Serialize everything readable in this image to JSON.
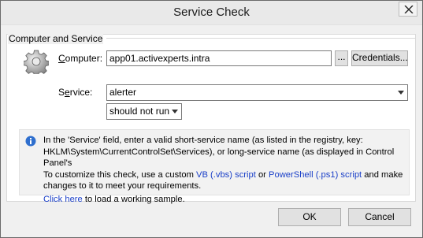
{
  "window": {
    "title": "Service Check"
  },
  "group": {
    "label": "Computer and Service"
  },
  "computer": {
    "label_underlined": "C",
    "label_rest": "omputer:",
    "value": "app01.activexperts.intra",
    "browse_label": "...",
    "credentials_label": "Credentials..."
  },
  "service": {
    "label_prefix": "S",
    "label_underlined": "e",
    "label_rest": "rvice:",
    "value": "alerter",
    "condition": "should not run"
  },
  "info": {
    "line1": "In the 'Service' field, enter a valid short-service name (as listed in the registry, key:",
    "line2": "HKLM\\System\\CurrentControlSet\\Services), or long-service name (as displayed in Control Panel's",
    "line3_a": "To customize this check, use a custom ",
    "line3_link1": "VB (.vbs) script",
    "line3_b": " or ",
    "line3_link2": "PowerShell (.ps1) script",
    "line3_c": " and make",
    "line4": "changes to it to meet your requirements.",
    "line5_link": "Click here",
    "line5_rest": " to load a working sample."
  },
  "buttons": {
    "ok": "OK",
    "cancel": "Cancel"
  },
  "icons": {
    "close": "close-icon",
    "gear": "gear-icon",
    "info": "info-icon",
    "dropdown": "chevron-down-icon"
  }
}
